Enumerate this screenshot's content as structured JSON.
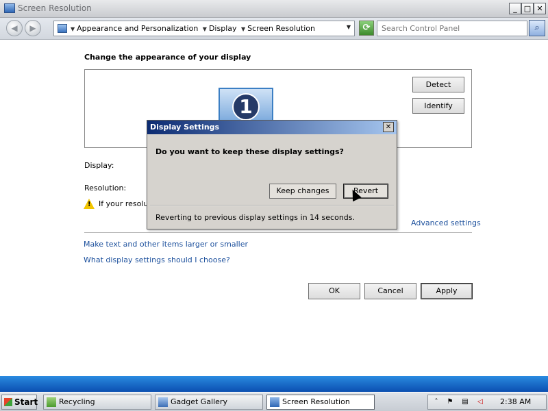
{
  "window": {
    "title": "Screen Resolution",
    "minimize": "_",
    "maximize": "□",
    "close": "✕"
  },
  "address": {
    "breadcrumbs": [
      "Appearance and Personalization",
      "Display",
      "Screen Resolution"
    ],
    "search_placeholder": "Search Control Panel"
  },
  "main": {
    "heading": "Change the appearance of your display",
    "monitor_number": "1",
    "detect_label": "Detect",
    "identify_label": "Identify",
    "display_label": "Display:",
    "resolution_label": "Resolution:",
    "warning_text": "If your resolut",
    "advanced_link": "Advanced settings",
    "link_text_size": "Make text and other items larger or smaller",
    "link_choose": "What display settings should I choose?",
    "ok_label": "OK",
    "cancel_label": "Cancel",
    "apply_label": "Apply"
  },
  "dialog": {
    "title": "Display Settings",
    "close": "✕",
    "question": "Do you want to keep these display settings?",
    "keep_label": "Keep changes",
    "revert_label": "Revert",
    "status": "Reverting to previous display settings in 14 seconds."
  },
  "taskbar": {
    "start_label": "Start",
    "tasks": [
      {
        "label": "Recycling",
        "icon": "recycle-icon"
      },
      {
        "label": "Gadget Gallery",
        "icon": "gadget-icon"
      },
      {
        "label": "Screen Resolution",
        "icon": "display-icon"
      }
    ],
    "clock": "2:38 AM"
  }
}
